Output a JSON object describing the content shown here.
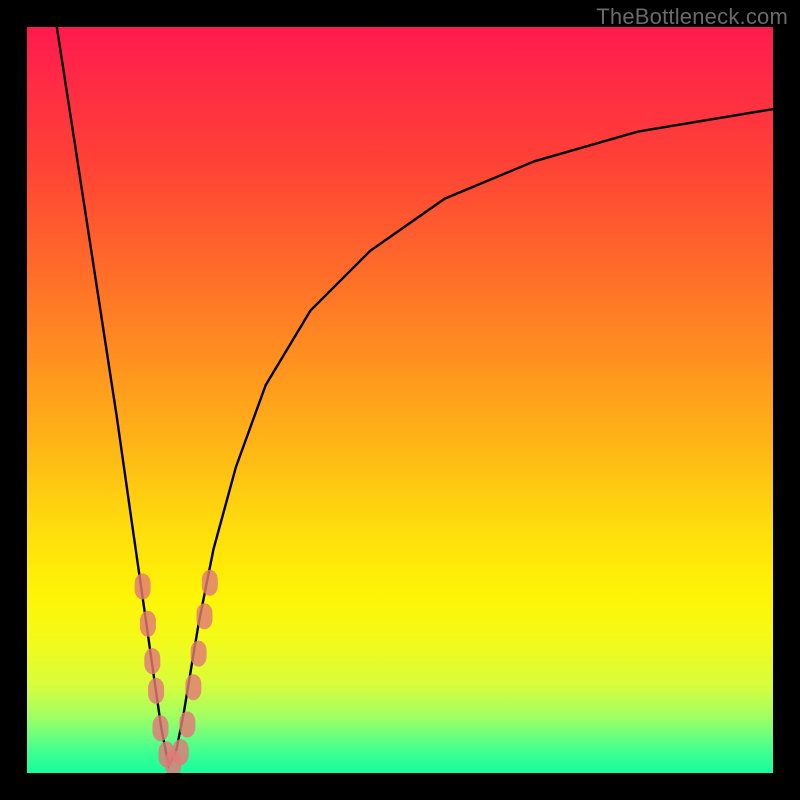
{
  "watermark": "TheBottleneck.com",
  "chart_data": {
    "type": "line",
    "title": "",
    "xlabel": "",
    "ylabel": "",
    "xlim": [
      0,
      100
    ],
    "ylim": [
      0,
      100
    ],
    "background_gradient": {
      "top_color": "#ff1a4d",
      "bottom_color": "#17ff9f",
      "meaning_hint": "red=high bottleneck, green=low bottleneck"
    },
    "series": [
      {
        "name": "bottleneck-curve",
        "comment": "x = relative component strength (0-100), y = bottleneck percentage (0-100). Minimum near x≈19.",
        "x": [
          4,
          6,
          8,
          10,
          12,
          14,
          15,
          16,
          17,
          18,
          19,
          20,
          21,
          22,
          23,
          25,
          28,
          32,
          38,
          46,
          56,
          68,
          82,
          100
        ],
        "y": [
          100,
          87,
          74,
          61,
          48,
          34,
          27,
          20,
          13,
          6,
          1,
          3,
          8,
          14,
          20,
          30,
          41,
          52,
          62,
          70,
          77,
          82,
          86,
          89
        ]
      }
    ],
    "markers": {
      "comment": "salmon lozenge markers clustered around the valley, approximate readings",
      "points": [
        {
          "x": 15.5,
          "y": 25
        },
        {
          "x": 16.2,
          "y": 20
        },
        {
          "x": 16.8,
          "y": 15
        },
        {
          "x": 17.3,
          "y": 11
        },
        {
          "x": 17.9,
          "y": 6
        },
        {
          "x": 18.7,
          "y": 2.5
        },
        {
          "x": 19.6,
          "y": 1.3
        },
        {
          "x": 20.6,
          "y": 2.8
        },
        {
          "x": 21.5,
          "y": 6.5
        },
        {
          "x": 22.3,
          "y": 11.5
        },
        {
          "x": 23.0,
          "y": 16
        },
        {
          "x": 23.8,
          "y": 21
        },
        {
          "x": 24.5,
          "y": 25.5
        }
      ]
    }
  }
}
